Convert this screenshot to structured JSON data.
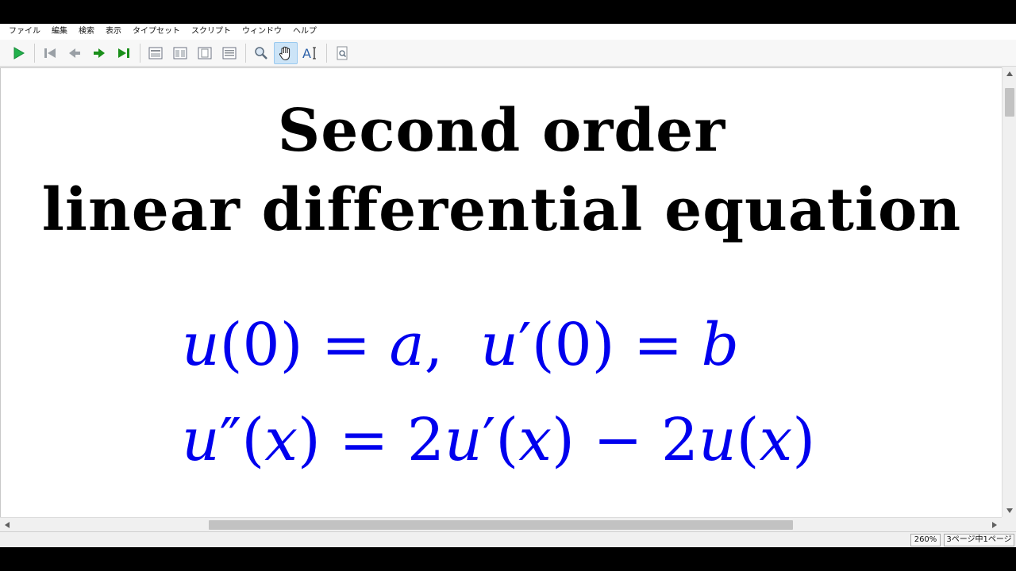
{
  "menu": [
    "ファイル",
    "編集",
    "検索",
    "表示",
    "タイプセット",
    "スクリプト",
    "ウィンドウ",
    "ヘルプ"
  ],
  "toolbar": {
    "buttons": [
      {
        "icon": "typeset-play-icon"
      },
      {
        "icon": "first-page-icon"
      },
      {
        "icon": "previous-page-icon"
      },
      {
        "icon": "next-page-icon"
      },
      {
        "icon": "last-page-icon"
      },
      {
        "icon": "page-view-single-icon"
      },
      {
        "icon": "page-view-facing-icon"
      },
      {
        "icon": "page-view-continuous-icon"
      },
      {
        "icon": "page-view-width-icon"
      },
      {
        "icon": "magnifier-icon"
      },
      {
        "icon": "hand-tool-icon",
        "active": true
      },
      {
        "icon": "text-select-icon"
      },
      {
        "icon": "find-icon"
      }
    ],
    "colors": {
      "play": "#22b14c",
      "arrows": "#1a8f1a",
      "active_bg": "#cce4f7"
    }
  },
  "document": {
    "title_line1": "Second order",
    "title_line2": "linear differential equation",
    "equation1": "u(0) = a,  u′(0) = b",
    "equation2": "u″(x) = 2u′(x) − 2u(x)",
    "title_color": "#000000",
    "equation_color": "#0000ee"
  },
  "status": {
    "zoom": "260%",
    "page": "3ページ中1ページ"
  }
}
